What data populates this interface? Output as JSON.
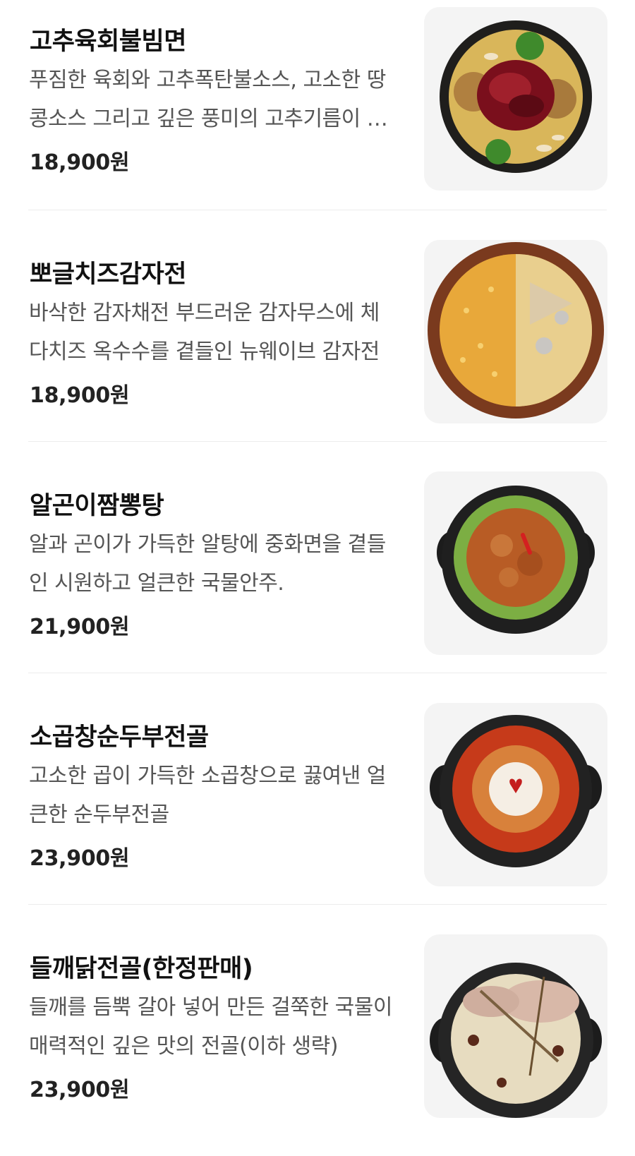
{
  "menu": {
    "items": [
      {
        "name": "고추육회불빔면",
        "description": "푸짐한 육회와 고추폭탄불소스, 고소한 땅콩소스 그리고 깊은 풍미의 고추기름이 어우러진 비빔면",
        "price": "18,900원",
        "image_icon": "spicy-beef-tartare-noodle-dish-icon"
      },
      {
        "name": "뽀글치즈감자전",
        "description": "바삭한 감자채전 부드러운 감자무스에 체다치즈 옥수수를 곁들인 뉴웨이브 감자전",
        "price": "18,900원",
        "image_icon": "cheese-potato-pancake-dish-icon"
      },
      {
        "name": "알곤이짬뽕탕",
        "description": "알과 곤이가 가득한 알탕에 중화면을 곁들인 시원하고 얼큰한 국물안주.",
        "price": "21,900원",
        "image_icon": "spicy-roe-soup-dish-icon"
      },
      {
        "name": "소곱창순두부전골",
        "description": "고소한 곱이 가득한 소곱창으로 끓여낸 얼큰한 순두부전골",
        "price": "23,900원",
        "image_icon": "tripe-soft-tofu-stew-dish-icon"
      },
      {
        "name": "들깨닭전골(한정판매)",
        "description": "들깨를 듬뿍 갈아 넣어 만든 걸쭉한 국물이 매력적인 깊은 맛의 전골(이하 생략)",
        "price": "23,900원",
        "image_icon": "perilla-chicken-hotpot-dish-icon"
      }
    ]
  }
}
